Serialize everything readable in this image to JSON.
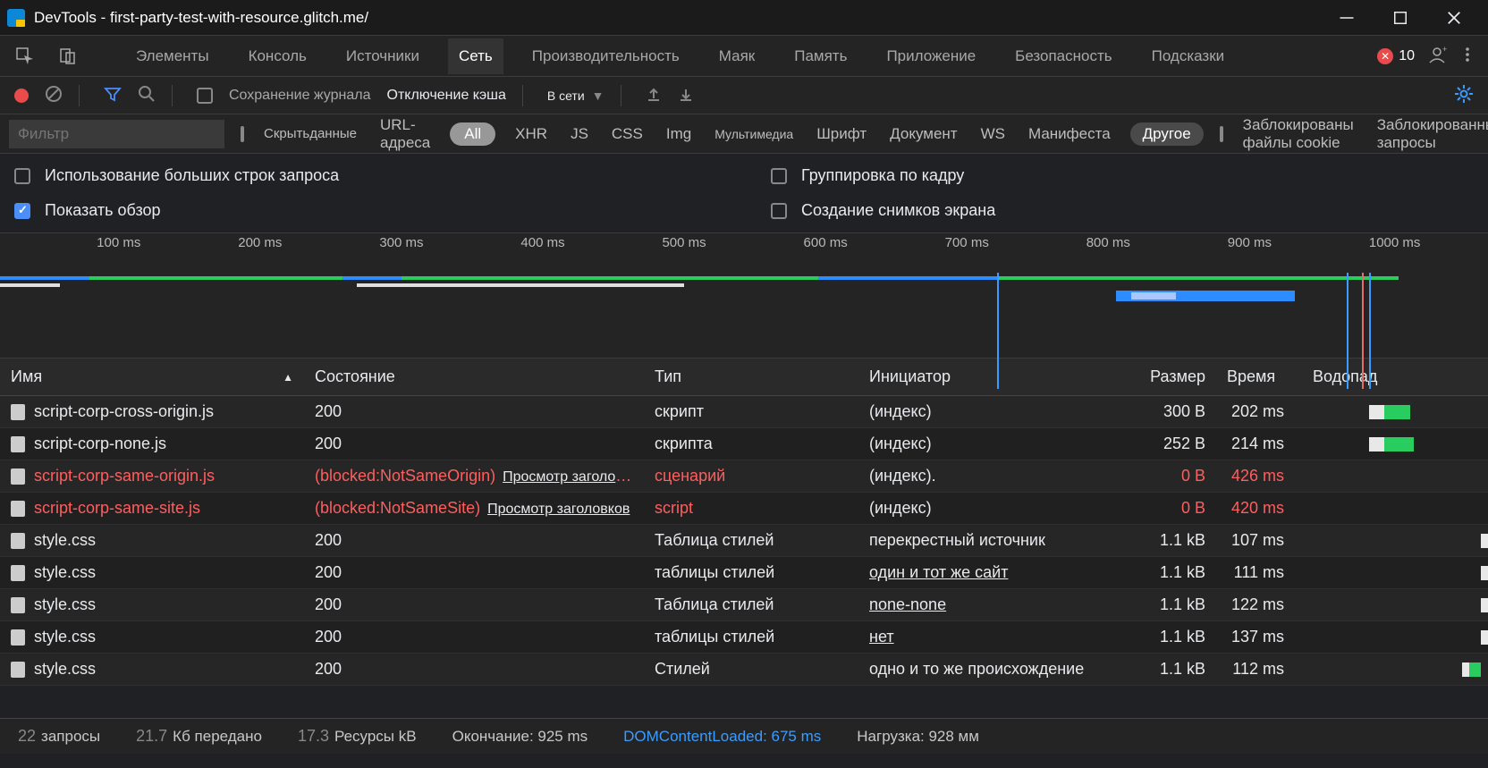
{
  "titlebar": {
    "title": "DevTools - first-party-test-with-resource.glitch.me/"
  },
  "tabs": {
    "elements": "Элементы",
    "console": "Консоль",
    "sources": "Источники",
    "network": "Сеть",
    "performance": "Производительность",
    "lighthouse": "Маяк",
    "memory": "Память",
    "application": "Приложение",
    "security": "Безопасность",
    "hints": "Подсказки",
    "errors": "10"
  },
  "toolbar": {
    "preserve_log": "Сохранение журнала",
    "disable_cache": "Отключение кэша",
    "online": "В сети"
  },
  "filter": {
    "placeholder": "Фильтр",
    "hide_data": "Скрытьданные",
    "url_addr": "URL-адреса",
    "all": "All",
    "xhr": "XHR",
    "js": "JS",
    "css": "CSS",
    "img": "Img",
    "media": "Мультимедиа",
    "font": "Шрифт",
    "doc": "Документ",
    "ws": "WS",
    "manifest": "Манифеста",
    "other": "Другое",
    "blocked_cookies": "Заблокированы файлы cookie",
    "blocked_requests": "Заблокированные запросы"
  },
  "options": {
    "large_rows": "Использование больших строк запроса",
    "show_overview": "Показать обзор",
    "group_frame": "Группировка по кадру",
    "screenshots": "Создание снимков экрана"
  },
  "timeline_ticks": [
    "100 ms",
    "200 ms",
    "300 ms",
    "400 ms",
    "500 ms",
    "600 ms",
    "700 ms",
    "800 ms",
    "900 ms",
    "1000 ms"
  ],
  "columns": {
    "name": "Имя",
    "status": "Состояние",
    "type": "Тип",
    "initiator": "Инициатор",
    "size": "Размер",
    "time": "Время",
    "waterfall": "Водопад"
  },
  "rows": [
    {
      "name": "script-corp-cross-origin.js",
      "status": "200",
      "hdr": "",
      "type": "скрипт",
      "initiator": "(индекс)",
      "init_u": false,
      "size": "300 B",
      "time": "202 ms",
      "err": false,
      "wf": [
        36,
        8,
        14
      ]
    },
    {
      "name": "script-corp-none.js",
      "status": "200",
      "hdr": "",
      "type": "скрипта",
      "initiator": "(индекс)",
      "init_u": false,
      "size": "252 B",
      "time": "214 ms",
      "err": false,
      "wf": [
        36,
        8,
        16
      ]
    },
    {
      "name": "script-corp-same-origin.js",
      "status": "(blocked:NotSameOrigin)",
      "hdr": "Просмотр заголовков",
      "type": "сценарий",
      "initiator": "(индекс).",
      "init_u": false,
      "size": "0 B",
      "time": "426 ms",
      "err": true,
      "wf": null
    },
    {
      "name": "script-corp-same-site.js",
      "status": "(blocked:NotSameSite)",
      "hdr": "Просмотр заголовков",
      "type": "script",
      "initiator": "(индекс)",
      "init_u": false,
      "size": "0 B",
      "time": "420 ms",
      "err": true,
      "wf": null
    },
    {
      "name": "style.css",
      "status": "200",
      "hdr": "",
      "type": "Таблица стилей",
      "initiator": "перекрестный источник",
      "init_u": false,
      "size": "1.1 kB",
      "time": "107 ms",
      "err": false,
      "wf": [
        96,
        4,
        6
      ]
    },
    {
      "name": "style.css",
      "status": "200",
      "hdr": "",
      "type": "таблицы стилей",
      "initiator": "один и тот же сайт",
      "init_u": true,
      "size": "1.1 kB",
      "time": "111 ms",
      "err": false,
      "wf": [
        96,
        4,
        6
      ]
    },
    {
      "name": "style.css",
      "status": "200",
      "hdr": "",
      "type": "Таблица стилей",
      "initiator": "none-none",
      "init_u": true,
      "size": "1.1 kB",
      "time": "122 ms",
      "err": false,
      "wf": [
        96,
        4,
        6
      ]
    },
    {
      "name": "style.css",
      "status": "200",
      "hdr": "",
      "type": "таблицы стилей",
      "initiator": "нет",
      "init_u": true,
      "size": "1.1 kB",
      "time": "137 ms",
      "err": false,
      "wf": [
        96,
        4,
        6
      ]
    },
    {
      "name": "style.css",
      "status": "200",
      "hdr": "",
      "type": "Стилей",
      "initiator": "одно и то же происхождение",
      "init_u": false,
      "size": "1.1 kB",
      "time": "112 ms",
      "err": false,
      "wf": [
        86,
        4,
        6
      ]
    }
  ],
  "statusbar": {
    "req_n": "22",
    "req_l": "запросы",
    "xfer_n": "21.7",
    "xfer_l": "Кб передано",
    "res_n": "17.3",
    "res_l": "Ресурсы kB",
    "finish": "Окончание: 925 ms",
    "dcl": "DOMContentLoaded: 675 ms",
    "load": "Нагрузка: 928 мм"
  }
}
